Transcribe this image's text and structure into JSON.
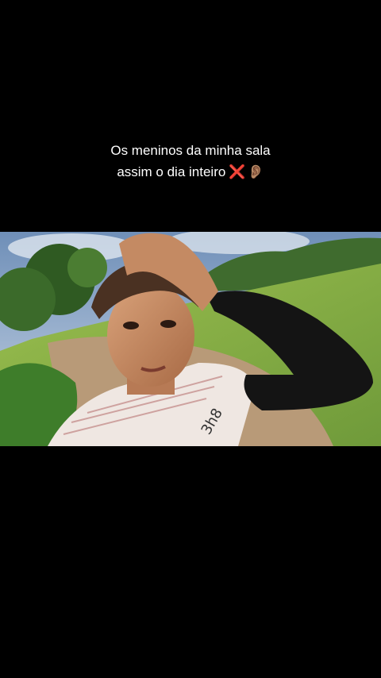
{
  "caption": {
    "line1": "Os meninos da minha sala",
    "line2": "assim o dia inteiro",
    "emoji_cross": "❌",
    "emoji_ear": "👂🏽"
  },
  "video": {
    "shirt_print": "3h8"
  },
  "colors": {
    "background": "#000000",
    "caption_text": "#ffffff",
    "cross": "#e02020"
  }
}
